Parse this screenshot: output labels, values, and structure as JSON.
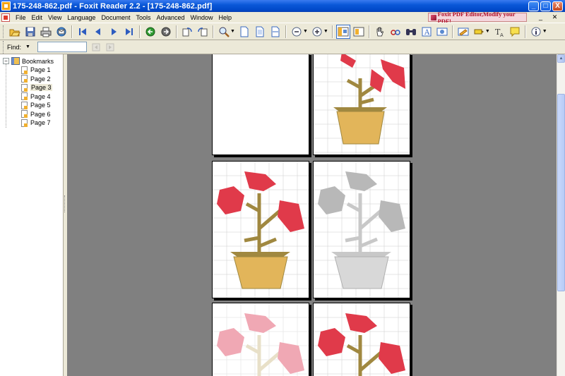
{
  "window": {
    "title": "175-248-862.pdf - Foxit Reader 2.2 - [175-248-862.pdf]",
    "controls": {
      "minimize": "_",
      "maximize": "□",
      "close": "X"
    }
  },
  "menu": {
    "items": [
      "File",
      "Edit",
      "View",
      "Language",
      "Document",
      "Tools",
      "Advanced",
      "Window",
      "Help"
    ],
    "promo": "Foxit PDF Editor,Modify your PDF!",
    "mdi_minimize": "_",
    "mdi_close": "✕"
  },
  "toolbar": {
    "icons": [
      "open-icon",
      "save-icon",
      "print-icon",
      "email-icon",
      "first-page-icon",
      "prev-page-icon",
      "next-page-icon",
      "last-page-icon",
      "go-back-icon",
      "go-forward-icon",
      "rotate-left-icon",
      "rotate-right-icon",
      "zoom-icon",
      "actual-size-icon",
      "fit-page-icon",
      "fit-width-icon",
      "zoom-out-icon",
      "zoom-in-icon",
      "bookmarks-panel-icon",
      "hand-tool-icon",
      "snapshot-icon",
      "find-icon",
      "typewriter-icon",
      "image-icon",
      "text-edit-icon",
      "highlight-icon",
      "text-tool-icon",
      "note-icon",
      "info-icon"
    ]
  },
  "findbar": {
    "label": "Find:",
    "dropdown": "▼",
    "value": "",
    "placeholder": ""
  },
  "bookmarks": {
    "root": "Bookmarks",
    "toggle": "−",
    "items": [
      {
        "label": "Page 1",
        "selected": false
      },
      {
        "label": "Page 2",
        "selected": false
      },
      {
        "label": "Page 3",
        "selected": true
      },
      {
        "label": "Page 4",
        "selected": false
      },
      {
        "label": "Page 5",
        "selected": false
      },
      {
        "label": "Page 6",
        "selected": false
      },
      {
        "label": "Page 7",
        "selected": false
      }
    ]
  },
  "colors": {
    "flower_red": "#e03a4a",
    "flower_faded": "#f0a8b4",
    "stem": "#a08840",
    "pot": "#e2b55a",
    "canvas_gray": "#808080"
  },
  "scrollbar": {
    "up": "▲",
    "down": "▼"
  }
}
